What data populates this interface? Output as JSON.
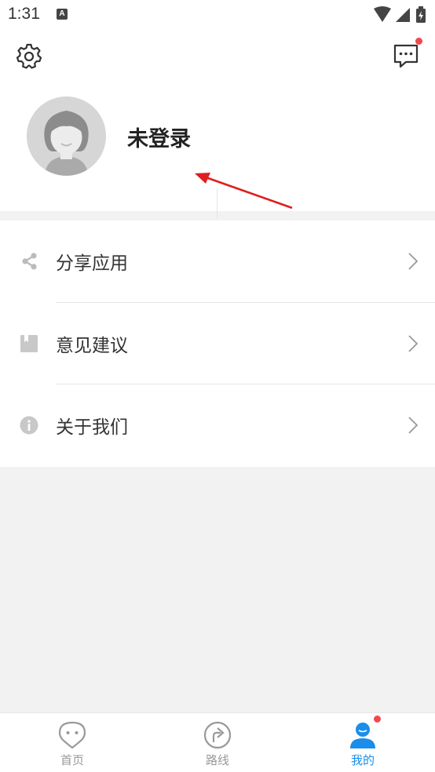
{
  "status_bar": {
    "time": "1:31",
    "notification_icon": "a-letter-icon",
    "icons": [
      "wifi-icon",
      "signal-icon",
      "battery-charging-icon"
    ]
  },
  "header": {
    "settings_icon": "gear-icon",
    "message_icon": "chat-bubble-icon",
    "has_unread_dot": true,
    "login_status": "未登录"
  },
  "menu": {
    "items": [
      {
        "label": "分享应用",
        "icon": "share-icon"
      },
      {
        "label": "意见建议",
        "icon": "bookmark-icon"
      },
      {
        "label": "关于我们",
        "icon": "info-icon"
      }
    ]
  },
  "tabbar": {
    "tabs": [
      {
        "label": "首页",
        "icon": "home-location-icon",
        "active": false
      },
      {
        "label": "路线",
        "icon": "route-arrow-icon",
        "active": false
      },
      {
        "label": "我的",
        "icon": "profile-icon",
        "active": true,
        "has_dot": true
      }
    ]
  },
  "colors": {
    "accent": "#1a8eea",
    "badge": "#f2474f",
    "arrow_annotation": "#e01e1e",
    "background": "#f2f2f2"
  }
}
